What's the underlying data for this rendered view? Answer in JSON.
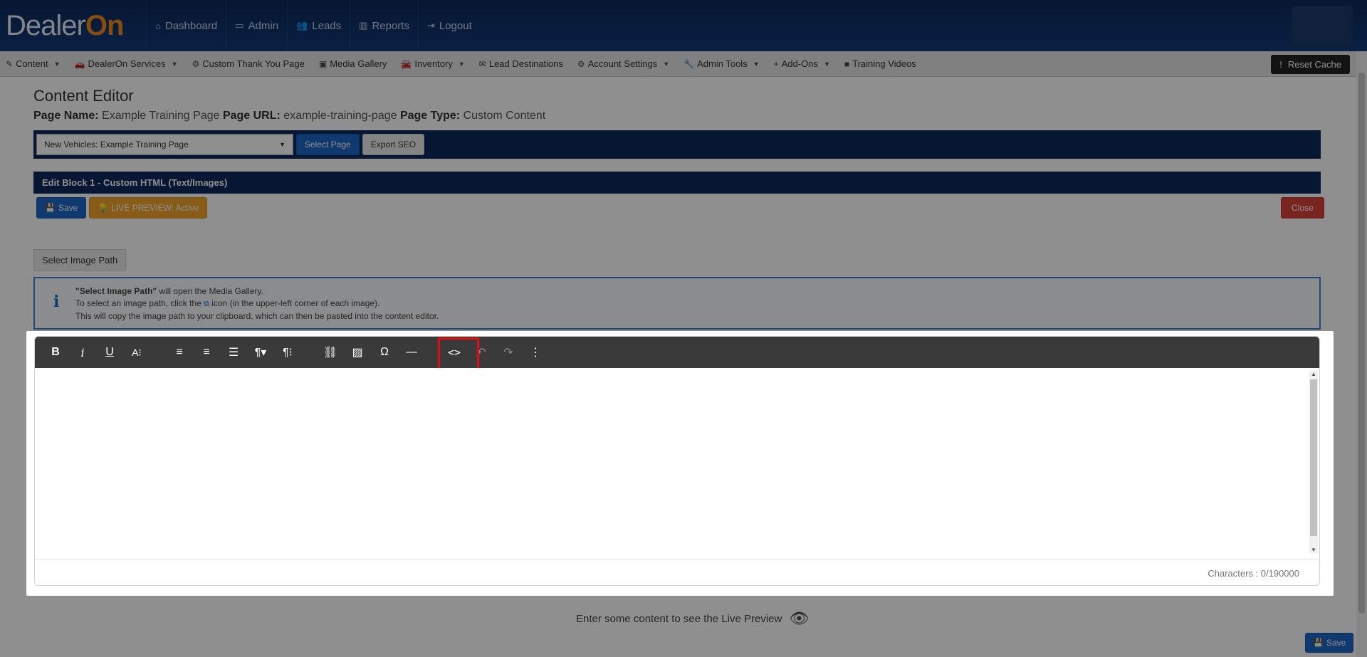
{
  "brand": {
    "name_a": "Dealer",
    "name_b": "On"
  },
  "topnav": [
    {
      "label": "Dashboard",
      "icon": "⌂"
    },
    {
      "label": "Admin",
      "icon": "▭"
    },
    {
      "label": "Leads",
      "icon": "👥"
    },
    {
      "label": "Reports",
      "icon": "▥"
    },
    {
      "label": "Logout",
      "icon": "⇥"
    }
  ],
  "subnav": [
    {
      "label": "Content",
      "icon": "✎",
      "caret": "▼"
    },
    {
      "label": "DealerOn Services",
      "icon": "🚗",
      "caret": "▼"
    },
    {
      "label": "Custom Thank You Page",
      "icon": "⚙",
      "caret": ""
    },
    {
      "label": "Media Gallery",
      "icon": "▣",
      "caret": ""
    },
    {
      "label": "Inventory",
      "icon": "🚘",
      "caret": "▼"
    },
    {
      "label": "Lead Destinations",
      "icon": "✉",
      "caret": ""
    },
    {
      "label": "Account Settings",
      "icon": "⚙",
      "caret": "▼"
    },
    {
      "label": "Admin Tools",
      "icon": "🔧",
      "caret": "▼"
    },
    {
      "label": "Add-Ons",
      "icon": "+",
      "caret": "▼"
    },
    {
      "label": "Training Videos",
      "icon": "■",
      "caret": ""
    }
  ],
  "reset_cache": "Reset Cache",
  "editor_title": "Content Editor",
  "page_info": {
    "name_label": "Page Name:",
    "name": "Example Training Page",
    "url_label": "Page URL:",
    "url": "example-training-page",
    "type_label": "Page Type:",
    "type": "Custom Content"
  },
  "page_select": {
    "value": "New Vehicles: Example Training Page",
    "caret": "▼"
  },
  "select_page_btn": "Select Page",
  "export_seo_btn": "Export SEO",
  "block_title": "Edit Block 1 - Custom HTML (Text/Images)",
  "save_btn": "Save",
  "live_preview_btn": "LIVE PREVIEW: Active",
  "close_btn": "Close",
  "select_image_path_btn": "Select Image Path",
  "info": {
    "line1_bold": "\"Select Image Path\"",
    "line1_rest": " will open the Media Gallery.",
    "line2_a": "To select an image path, click the ",
    "line2_b": " icon (in the upper-left corner of each image).",
    "line3": "This will copy the image path to your clipboard, which can then be pasted into the content editor."
  },
  "toolbar": {
    "bold": "B",
    "italic": "i",
    "underline": "U",
    "fontsize": "A⁝",
    "align_left": "≡",
    "align_center": "≡",
    "ordered_list": "☰",
    "paragraph": "¶▾",
    "paragraph_style": "¶⁝",
    "link": "⛓",
    "image": "▨",
    "special_char": "Ω",
    "hr": "—",
    "code_view": "<>",
    "undo": "↶",
    "redo": "↷",
    "more": "⋮"
  },
  "char_count": "Characters : 0/190000",
  "preview_note": "Enter some content to see the Live Preview",
  "bottom_save": "Save"
}
